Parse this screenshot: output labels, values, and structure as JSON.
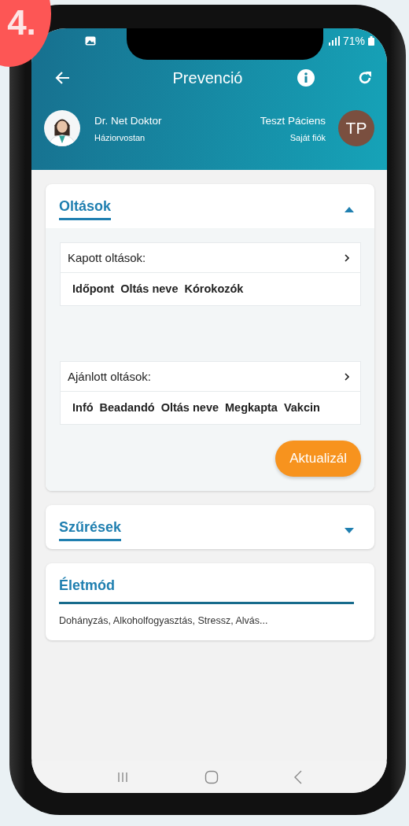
{
  "badge": {
    "text": "4."
  },
  "status_bar": {
    "battery": "71%"
  },
  "header": {
    "title": "Prevenció"
  },
  "doctor": {
    "name": "Dr. Net Doktor",
    "specialty": "Háziorvostan"
  },
  "patient": {
    "name": "Teszt Páciens",
    "subtitle": "Saját fiók",
    "initials": "TP"
  },
  "sections": [
    {
      "kind": "vaccinations",
      "title": "Oltások",
      "expanded": true,
      "tables": [
        {
          "title": "Kapott oltások:",
          "columns": [
            "Időpont",
            "Oltás neve",
            "Kórokozók"
          ]
        },
        {
          "title": "Ajánlott oltások:",
          "columns": [
            "Infó",
            "Beadandó",
            "Oltás neve",
            "Megkapta",
            "Vakcin"
          ]
        }
      ],
      "button": "Aktualizál"
    },
    {
      "kind": "collapsible",
      "title": "Szűrések",
      "expanded": false
    },
    {
      "kind": "summary",
      "title": "Életmód",
      "text": "Dohányzás, Alkoholfogyasztás, Stressz, Alvás..."
    }
  ]
}
